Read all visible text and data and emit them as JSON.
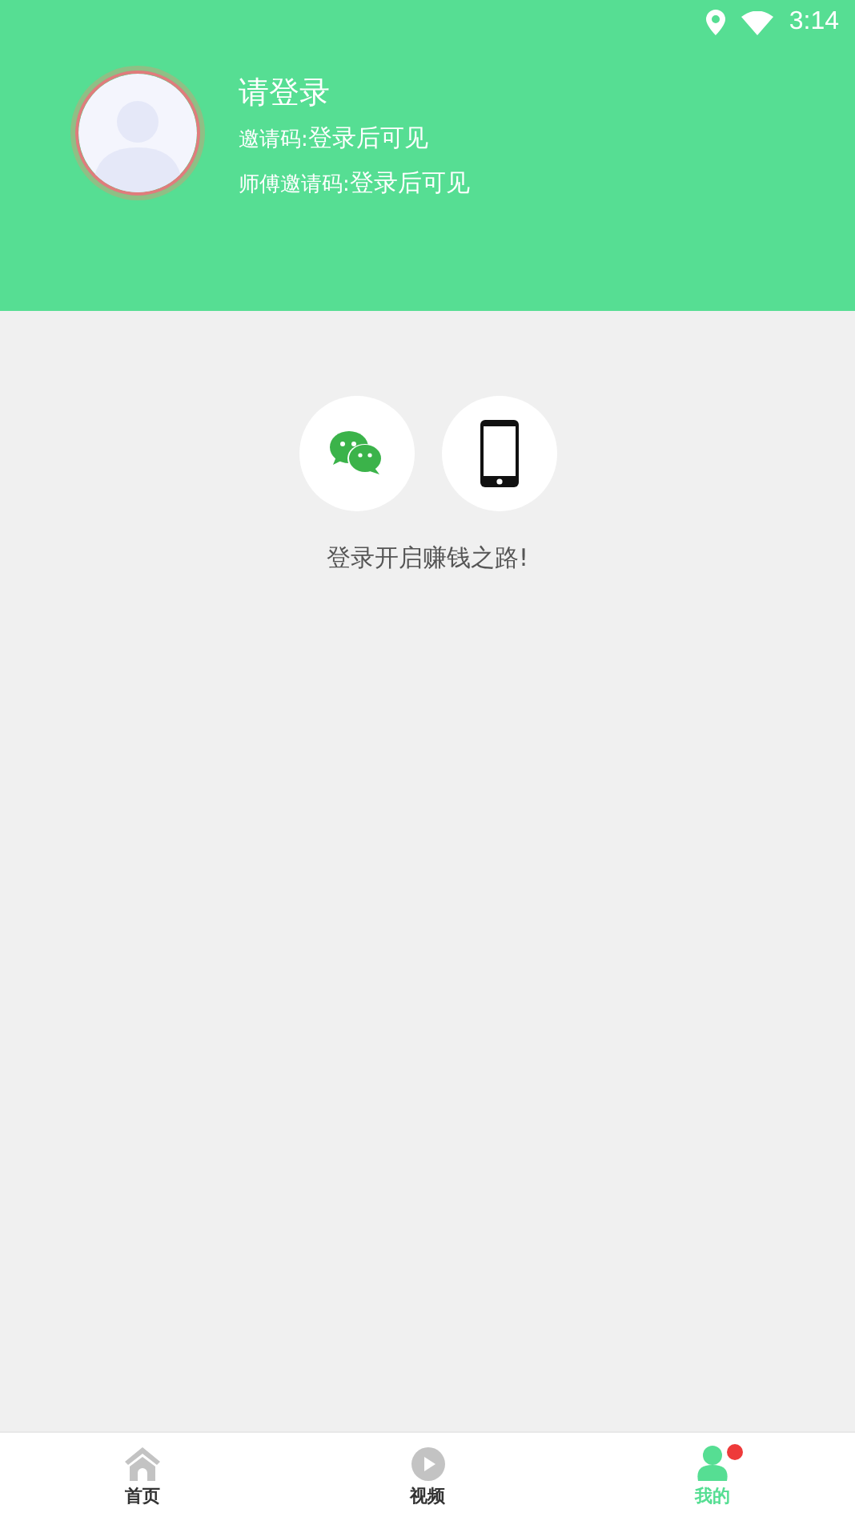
{
  "status_bar": {
    "time": "3:14"
  },
  "profile": {
    "title": "请登录",
    "lines": [
      {
        "label": "邀请码:",
        "value": "登录后可见"
      },
      {
        "label": "师傅邀请码:",
        "value": "登录后可见"
      }
    ]
  },
  "login_options": [
    {
      "kind": "wechat"
    },
    {
      "kind": "phone"
    }
  ],
  "login_hint": "登录开启赚钱之路!",
  "tabs": [
    {
      "kind": "home",
      "label": "首页",
      "selected": false,
      "badge": false
    },
    {
      "kind": "video",
      "label": "视频",
      "selected": false,
      "badge": false
    },
    {
      "kind": "mine",
      "label": "我的",
      "selected": true,
      "badge": true
    }
  ]
}
